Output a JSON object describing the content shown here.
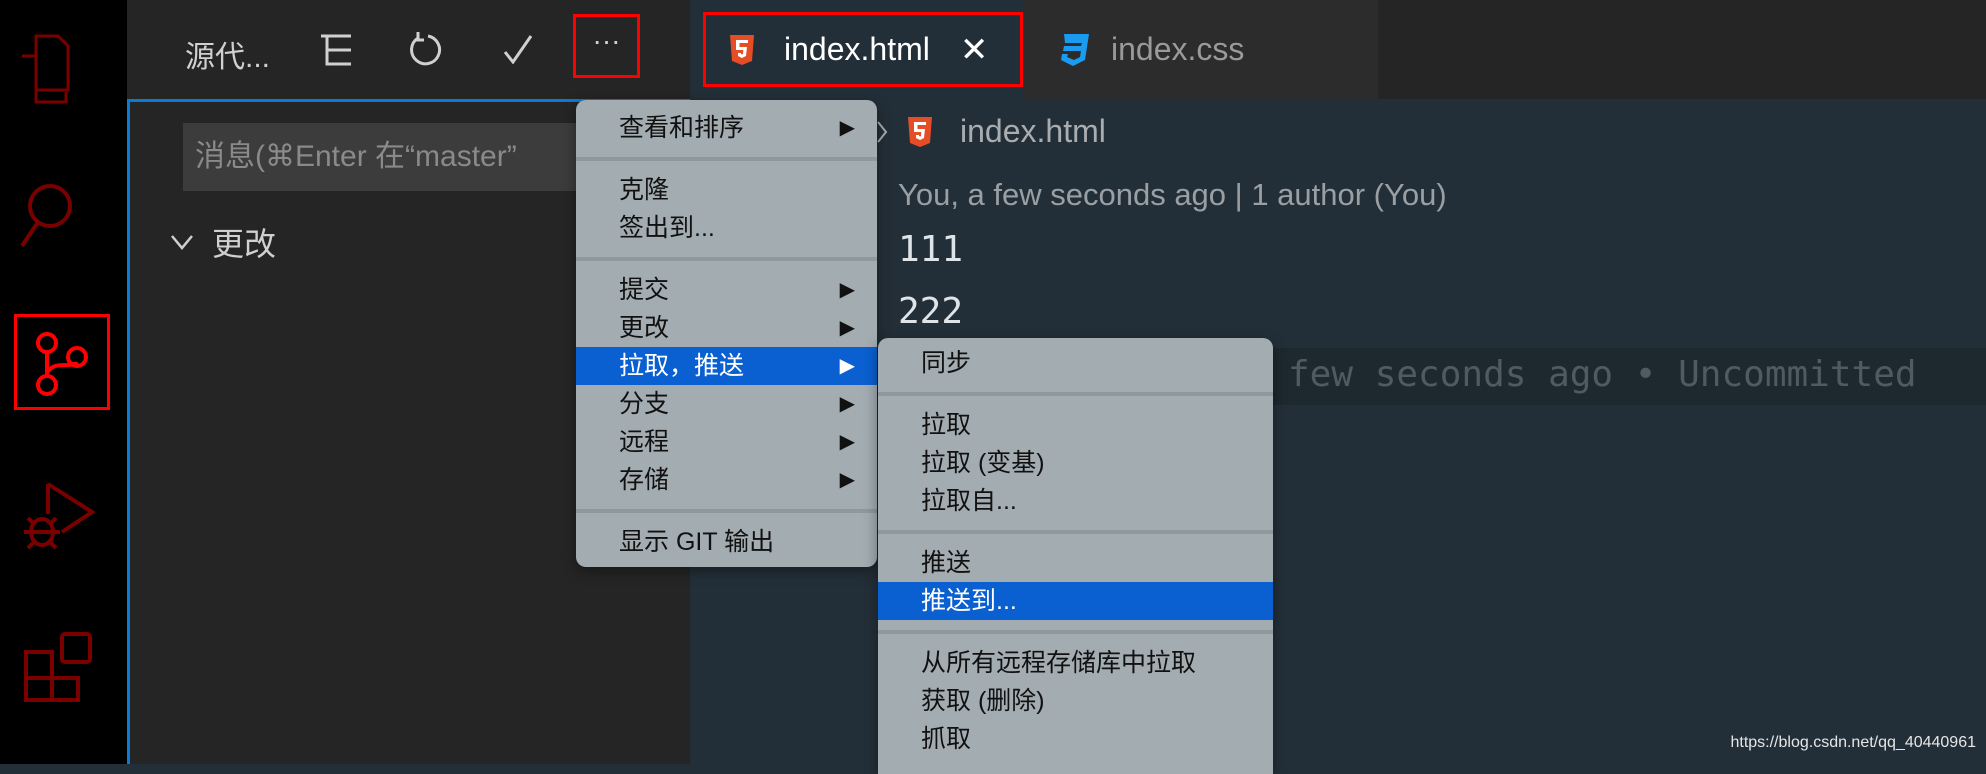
{
  "activity_bar": {
    "items": [
      {
        "name": "explorer",
        "icon": "files-icon"
      },
      {
        "name": "search",
        "icon": "search-icon"
      },
      {
        "name": "source-control",
        "icon": "source-control-icon",
        "active": true
      },
      {
        "name": "run-debug",
        "icon": "debug-icon"
      },
      {
        "name": "extensions",
        "icon": "extensions-icon"
      }
    ]
  },
  "sidebar": {
    "title": "源代...",
    "message_placeholder": "消息(⌘Enter 在“master”",
    "changes_label": "更改"
  },
  "tabs": [
    {
      "label": "index.html",
      "icon": "html5-icon",
      "active": true
    },
    {
      "label": "index.css",
      "icon": "css3-icon"
    }
  ],
  "breadcrumb": {
    "file": "index.html"
  },
  "editor": {
    "blame": "You, a few seconds ago | 1 author (You)",
    "lines": [
      "111",
      "222"
    ],
    "inline_blame": "few seconds ago • Uncommitted"
  },
  "menu": {
    "items": [
      {
        "label": "查看和排序",
        "sub": true
      },
      {
        "sep": true
      },
      {
        "label": "克隆"
      },
      {
        "label": "签出到..."
      },
      {
        "sep": true
      },
      {
        "label": "提交",
        "sub": true
      },
      {
        "label": "更改",
        "sub": true
      },
      {
        "label": "拉取，推送",
        "sub": true,
        "selected": true
      },
      {
        "label": "分支",
        "sub": true
      },
      {
        "label": "远程",
        "sub": true
      },
      {
        "label": "存储",
        "sub": true
      },
      {
        "sep": true
      },
      {
        "label": "显示 GIT 输出"
      }
    ]
  },
  "submenu": {
    "items": [
      {
        "label": "同步"
      },
      {
        "sep": true
      },
      {
        "label": "拉取"
      },
      {
        "label": "拉取 (变基)"
      },
      {
        "label": "拉取自..."
      },
      {
        "sep": true
      },
      {
        "label": "推送"
      },
      {
        "label": "推送到...",
        "selected": true
      },
      {
        "sep": true
      },
      {
        "label": "从所有远程存储库中拉取"
      },
      {
        "label": "获取 (删除)"
      },
      {
        "label": "抓取"
      }
    ]
  },
  "watermark": "https://blog.csdn.net/qq_40440961",
  "colors": {
    "highlight": "#0a60d0",
    "annotation": "#ff0000",
    "menu_bg": "#a2acb1"
  }
}
